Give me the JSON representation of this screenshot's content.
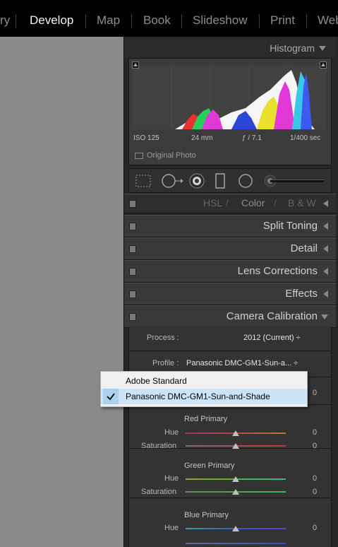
{
  "modules": [
    "ry",
    "Develop",
    "Map",
    "Book",
    "Slideshow",
    "Print",
    "Web"
  ],
  "active_module": "Develop",
  "histogram": {
    "title": "Histogram",
    "iso": "ISO 125",
    "focal": "24 mm",
    "aperture": "ƒ / 7.1",
    "shutter": "1/400 sec",
    "original_photo": "Original Photo"
  },
  "sections": {
    "hsl": [
      "HSL",
      "Color",
      "B & W"
    ],
    "split_toning": "Split Toning",
    "detail": "Detail",
    "lens_corrections": "Lens Corrections",
    "effects": "Effects",
    "camera_calibration": "Camera Calibration"
  },
  "calibration": {
    "process_label": "Process :",
    "process_value": "2012 (Current) ÷",
    "profile_label": "Profile :",
    "profile_value": "Panasonic DMC-GM1-Sun-a... ÷",
    "shadows_value": "0",
    "red": {
      "title": "Red Primary",
      "hue_label": "Hue",
      "hue": "0",
      "sat_label": "Saturation",
      "sat": "0"
    },
    "green": {
      "title": "Green Primary",
      "hue_label": "Hue",
      "hue": "0",
      "sat_label": "Saturation",
      "sat": "0"
    },
    "blue": {
      "title": "Blue Primary",
      "hue_label": "Hue",
      "hue": "0"
    }
  },
  "profile_menu": {
    "options": [
      "Adobe Standard",
      "Panasonic DMC-GM1-Sun-and-Shade"
    ],
    "selected_index": 1
  }
}
